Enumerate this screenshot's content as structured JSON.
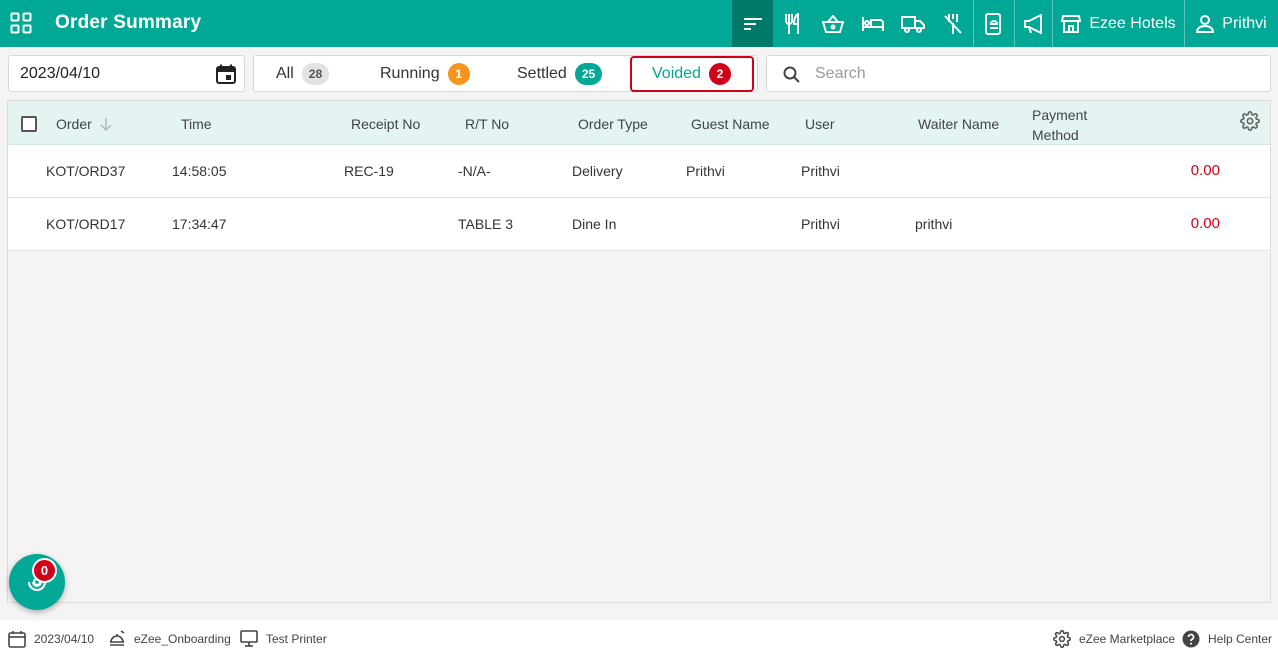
{
  "header": {
    "title": "Order Summary",
    "property_name": "Ezee Hotels",
    "user_name": "Prithvi",
    "brand_color": "#00a895",
    "icons": [
      "apps-grid-icon",
      "orders-list-icon",
      "restaurant-icon",
      "basket-icon",
      "hotel-bed-icon",
      "delivery-truck-icon",
      "no-service-icon",
      "mobile-order-icon",
      "announcement-icon",
      "store-icon",
      "user-icon"
    ]
  },
  "filters": {
    "date": "2023/04/10",
    "tabs": [
      {
        "label": "All",
        "count": "28"
      },
      {
        "label": "Running",
        "count": "1"
      },
      {
        "label": "Settled",
        "count": "25"
      },
      {
        "label": "Voided",
        "count": "2"
      }
    ],
    "active_tab": "Voided",
    "search_placeholder": "Search"
  },
  "table": {
    "columns": [
      "Order",
      "Time",
      "Receipt No",
      "R/T No",
      "Order Type",
      "Guest Name",
      "User",
      "Waiter Name",
      "Payment Method"
    ],
    "rows": [
      {
        "order": "KOT/ORD37",
        "time": "14:58:05",
        "receipt": "REC-19",
        "rt": "-N/A-",
        "type": "Delivery",
        "guest": "Prithvi",
        "user": "Prithvi",
        "waiter": "",
        "payment": "",
        "amount": "0.00"
      },
      {
        "order": "KOT/ORD17",
        "time": "17:34:47",
        "receipt": "",
        "rt": "TABLE 3",
        "type": "Dine In",
        "guest": "",
        "user": "Prithvi",
        "waiter": "prithvi",
        "payment": "",
        "amount": "0.00"
      }
    ]
  },
  "fab": {
    "badge": "0"
  },
  "statusbar": {
    "date": "2023/04/10",
    "outlet": "eZee_Onboarding",
    "printer": "Test Printer",
    "marketplace": "eZee Marketplace",
    "help": "Help Center"
  }
}
